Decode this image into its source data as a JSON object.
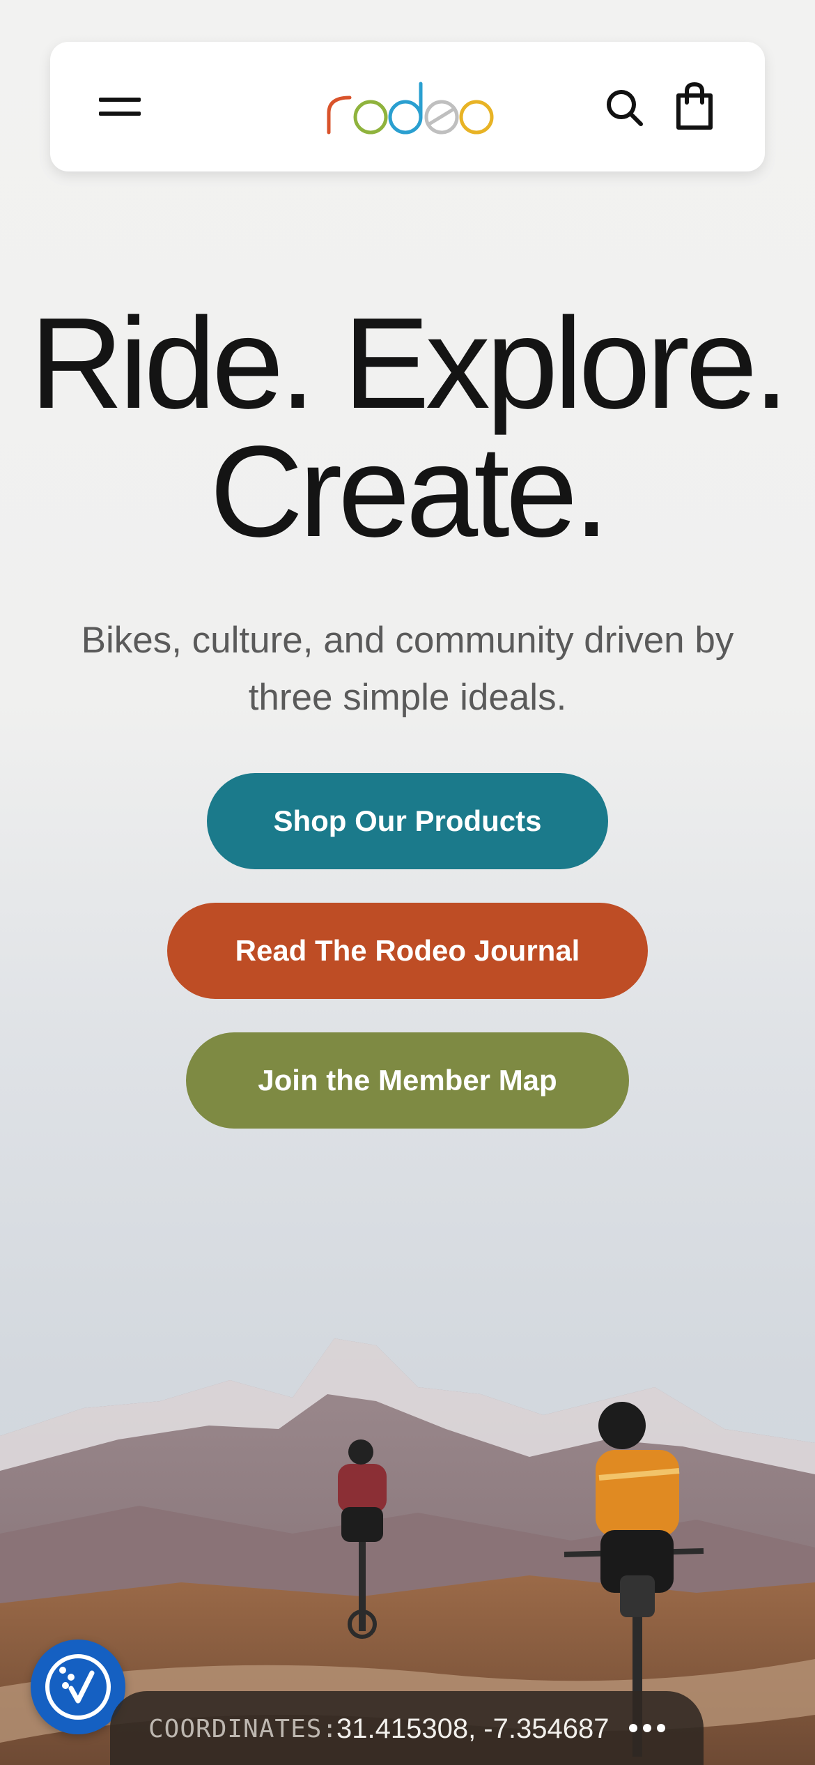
{
  "header": {
    "menu_icon": "hamburger-menu-icon",
    "logo_text": "rodeo",
    "logo_colors": [
      "#d9532b",
      "#8fb33d",
      "#2a9fd0",
      "#bfbfbf",
      "#e8b325"
    ],
    "search_icon": "search-icon",
    "cart_icon": "shopping-bag-icon"
  },
  "hero": {
    "title_line1": "Ride. Explore.",
    "title_line2": "Create.",
    "subtitle": "Bikes, culture, and community driven by three simple ideals."
  },
  "buttons": {
    "shop": "Shop Our Products",
    "journal": "Read The Rodeo Journal",
    "map": "Join the Member Map"
  },
  "colors": {
    "shop": "#1b7a8b",
    "journal": "#be4d25",
    "map": "#7e8a43",
    "accessibility": "#1560c2"
  },
  "accessibility_icon": "accessibility-widget-icon",
  "coordinates": {
    "label": "COORDINATES:",
    "value": "31.415308, -7.354687",
    "more_icon": "more-dots-icon"
  },
  "hero_image": "mountain-cyclists-photo"
}
